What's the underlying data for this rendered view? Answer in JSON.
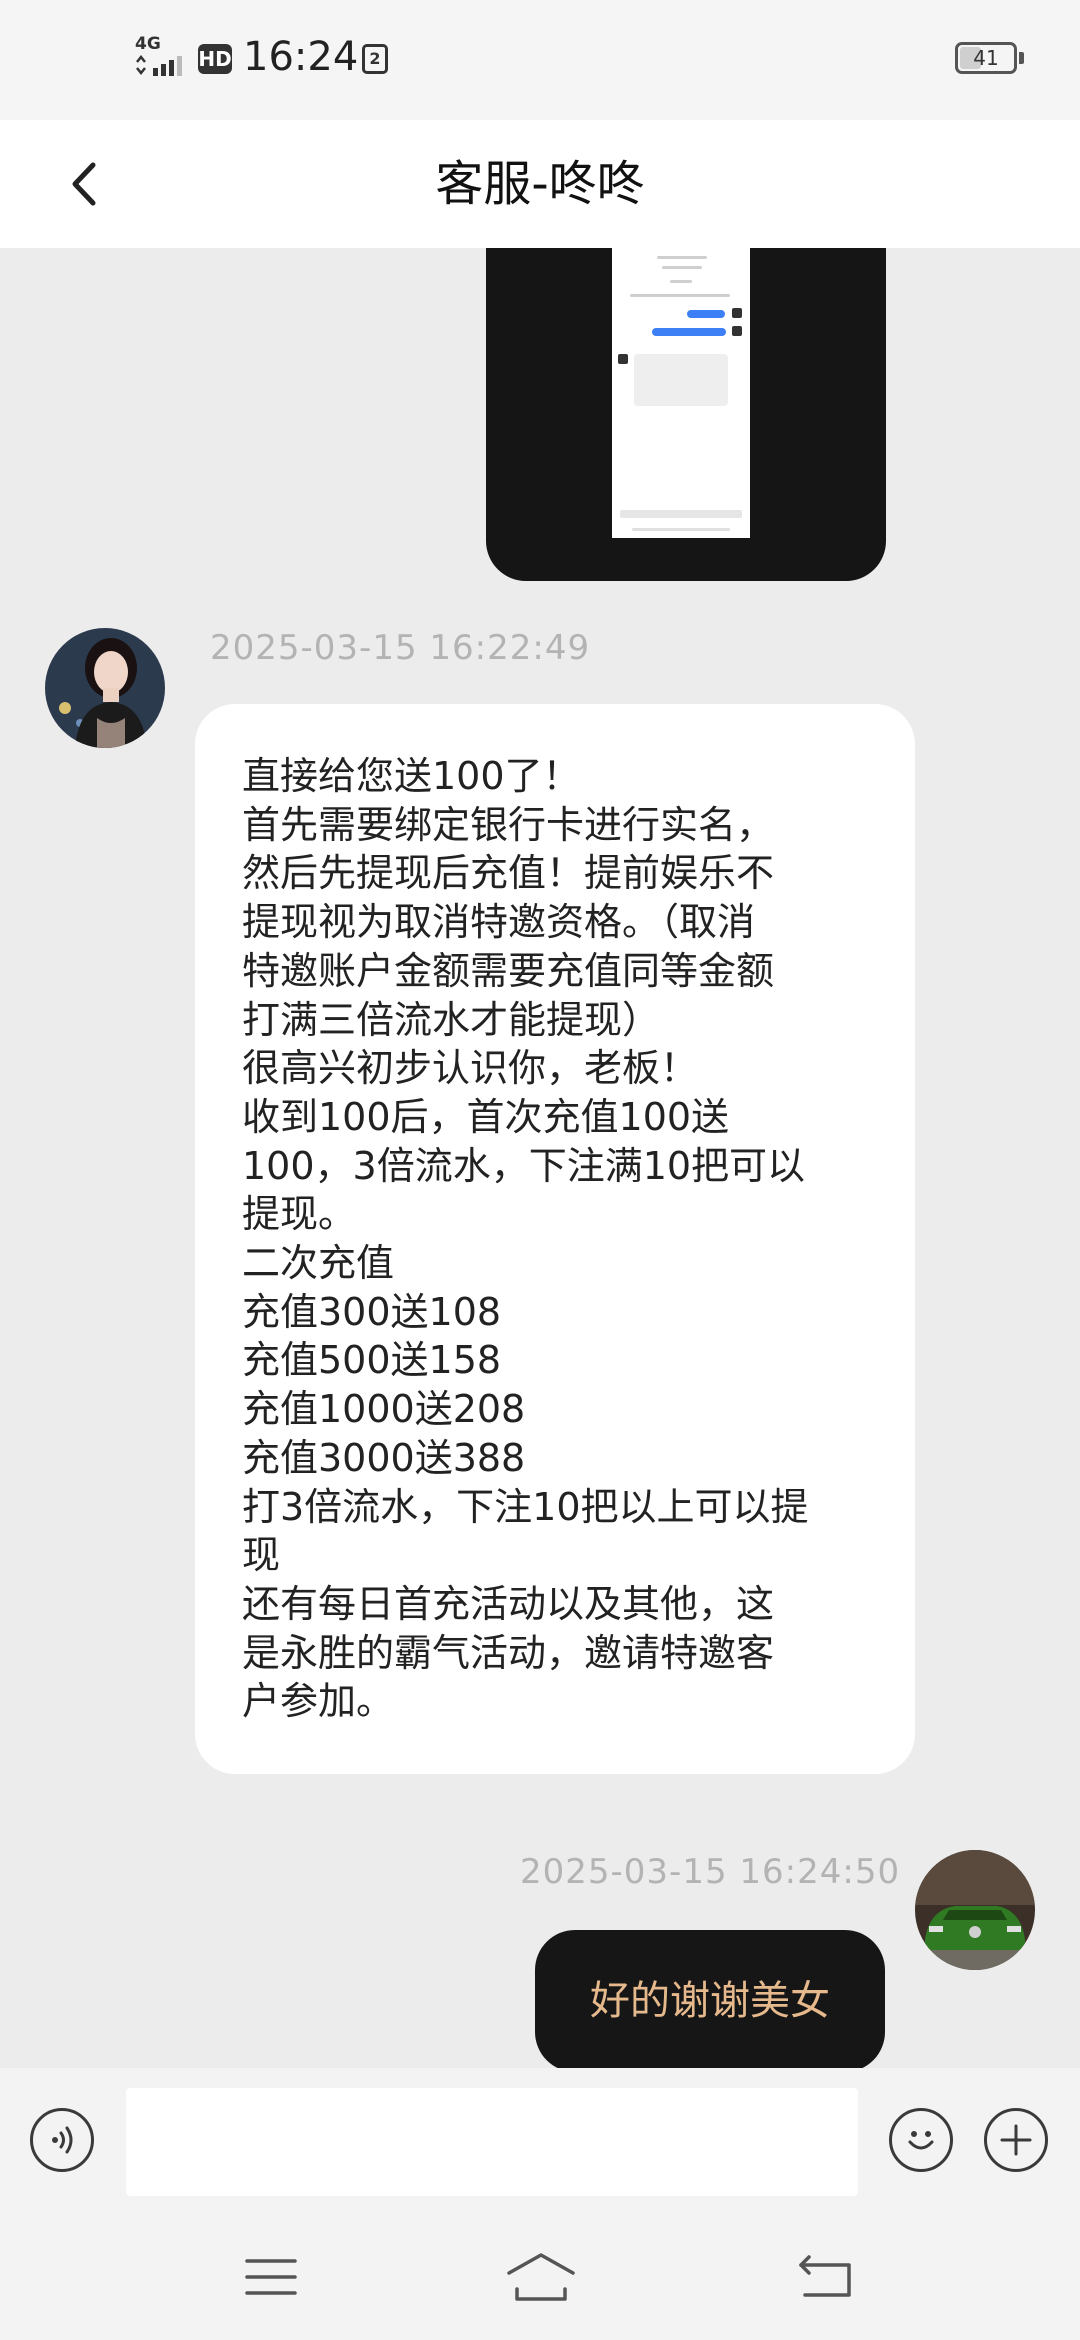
{
  "status_bar": {
    "network": "4G",
    "hd_badge": "HD",
    "time": "16:24",
    "sim_badge": "2",
    "battery": "41",
    "battery_level": 0.41
  },
  "header": {
    "title": "客服-咚咚"
  },
  "messages": [
    {
      "type": "image",
      "direction": "incoming"
    },
    {
      "type": "text",
      "direction": "incoming",
      "timestamp": "2025-03-15 16:22:49",
      "text": "直接给您送100了！\n首先需要绑定银行卡进行实名，\n然后先提现后充值！提前娱乐不\n提现视为取消特邀资格。（取消\n特邀账户金额需要充值同等金额\n打满三倍流水才能提现）\n很高兴初步认识你，老板！\n收到100后，首次充值100送\n100，3倍流水，下注满10把可以\n提现。\n二次充值\n充值300送108\n充值500送158\n充值1000送208\n充值3000送388\n打3倍流水，下注10把以上可以提\n现\n还有每日首充活动以及其他，这\n是永胜的霸气活动，邀请特邀客\n户参加。"
    },
    {
      "type": "text",
      "direction": "outgoing",
      "timestamp": "2025-03-15 16:24:50",
      "text": "好的谢谢美女"
    }
  ],
  "input_bar": {
    "placeholder": ""
  },
  "colors": {
    "chat_bg": "#ececec",
    "outgoing_bubble": "#161616",
    "outgoing_text": "#e6b98c",
    "timestamp": "#b3b3b3"
  },
  "icons": [
    "back-icon",
    "voice-icon",
    "emoji-icon",
    "plus-icon",
    "menu-icon",
    "home-icon",
    "return-icon"
  ]
}
